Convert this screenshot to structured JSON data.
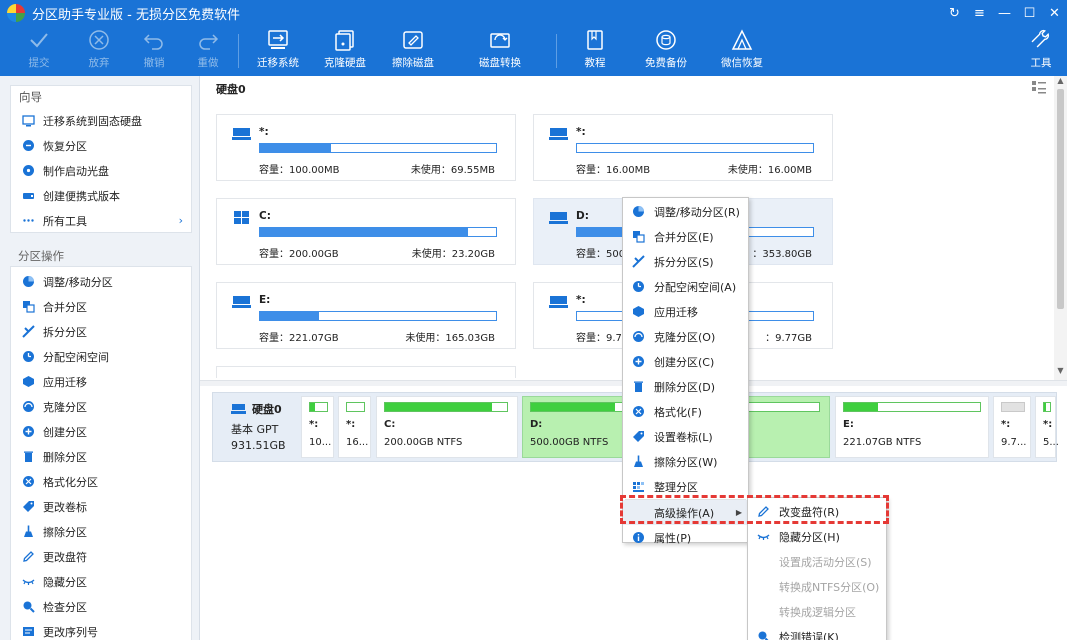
{
  "window": {
    "title": "分区助手专业版 - 无损分区免费软件",
    "controls": [
      "↻",
      "≡",
      "—",
      "☐",
      "✕"
    ]
  },
  "toolbar": {
    "commit": "提交",
    "discard": "放弃",
    "undo": "撤销",
    "redo": "重做",
    "migrate_os": "迁移系统",
    "clone_disk": "克隆硬盘",
    "wipe_disk": "擦除磁盘",
    "disk_convert": "磁盘转换",
    "tutorial": "教程",
    "free_backup": "免费备份",
    "wechat_recovery": "微信恢复",
    "tools": "工具"
  },
  "sidebar": {
    "wizard_title": "向导",
    "wizard_items": [
      "迁移系统到固态硬盘",
      "恢复分区",
      "制作启动光盘",
      "创建便携式版本",
      "所有工具"
    ],
    "ops_title": "分区操作",
    "ops_items": [
      "调整/移动分区",
      "合并分区",
      "拆分分区",
      "分配空闲空间",
      "应用迁移",
      "克隆分区",
      "创建分区",
      "删除分区",
      "格式化分区",
      "更改卷标",
      "擦除分区",
      "更改盘符",
      "隐藏分区",
      "检查分区",
      "更改序列号"
    ]
  },
  "main": {
    "disk_label": "硬盘0",
    "cards": [
      {
        "name": "*:",
        "cap": "容量：100.00MB",
        "free": "未使用：69.55MB",
        "fill": 0.3
      },
      {
        "name": "*:",
        "cap": "容量：16.00MB",
        "free": "未使用：16.00MB",
        "fill": 0.0
      },
      {
        "name": "C:",
        "cap": "容量：200.00GB",
        "free": "未使用：23.20GB",
        "fill": 0.88
      },
      {
        "name": "D:",
        "cap": "容量：500.0",
        "free": "：353.80GB",
        "fill": 0.29
      },
      {
        "name": "E:",
        "cap": "容量：221.07GB",
        "free": "未使用：165.03GB",
        "fill": 0.25
      },
      {
        "name": "*:",
        "cap": "容量：9.7",
        "free": "：9.77GB",
        "fill": 0.0
      }
    ]
  },
  "diskmap": {
    "name": "硬盘0",
    "type": "基本 GPT",
    "size": "931.51GB",
    "partitions": [
      {
        "name": "*:",
        "info": "10...",
        "fill": 0.3
      },
      {
        "name": "*:",
        "info": "16...",
        "fill": 0.0
      },
      {
        "name": "C:",
        "info": "200.00GB NTFS",
        "fill": 0.88
      },
      {
        "name": "D:",
        "info": "500.00GB NTFS",
        "fill": 0.29
      },
      {
        "name": "E:",
        "info": "221.07GB NTFS",
        "fill": 0.25
      },
      {
        "name": "*:",
        "info": "9.7...",
        "fill": 0.0
      },
      {
        "name": "*:",
        "info": "5...",
        "fill": 0.3
      }
    ]
  },
  "context_menu": {
    "items": [
      "调整/移动分区(R)",
      "合并分区(E)",
      "拆分分区(S)",
      "分配空闲空间(A)",
      "应用迁移",
      "克隆分区(O)",
      "创建分区(C)",
      "删除分区(D)",
      "格式化(F)",
      "设置卷标(L)",
      "擦除分区(W)",
      "整理分区",
      "高级操作(A)",
      "属性(P)"
    ],
    "advanced_arrow": "▶"
  },
  "submenu": {
    "items": [
      "改变盘符(R)",
      "隐藏分区(H)",
      "设置成活动分区(S)",
      "转换成NTFS分区(O)",
      "转换成逻辑分区",
      "检测错误(K)"
    ],
    "dim": [
      false,
      false,
      true,
      true,
      true,
      false
    ]
  },
  "colors": {
    "accent": "#1a73d6",
    "usage_bar": "#3e8ee8",
    "partition_bar": "#3fcf3f",
    "highlight_box": "#e53935"
  }
}
